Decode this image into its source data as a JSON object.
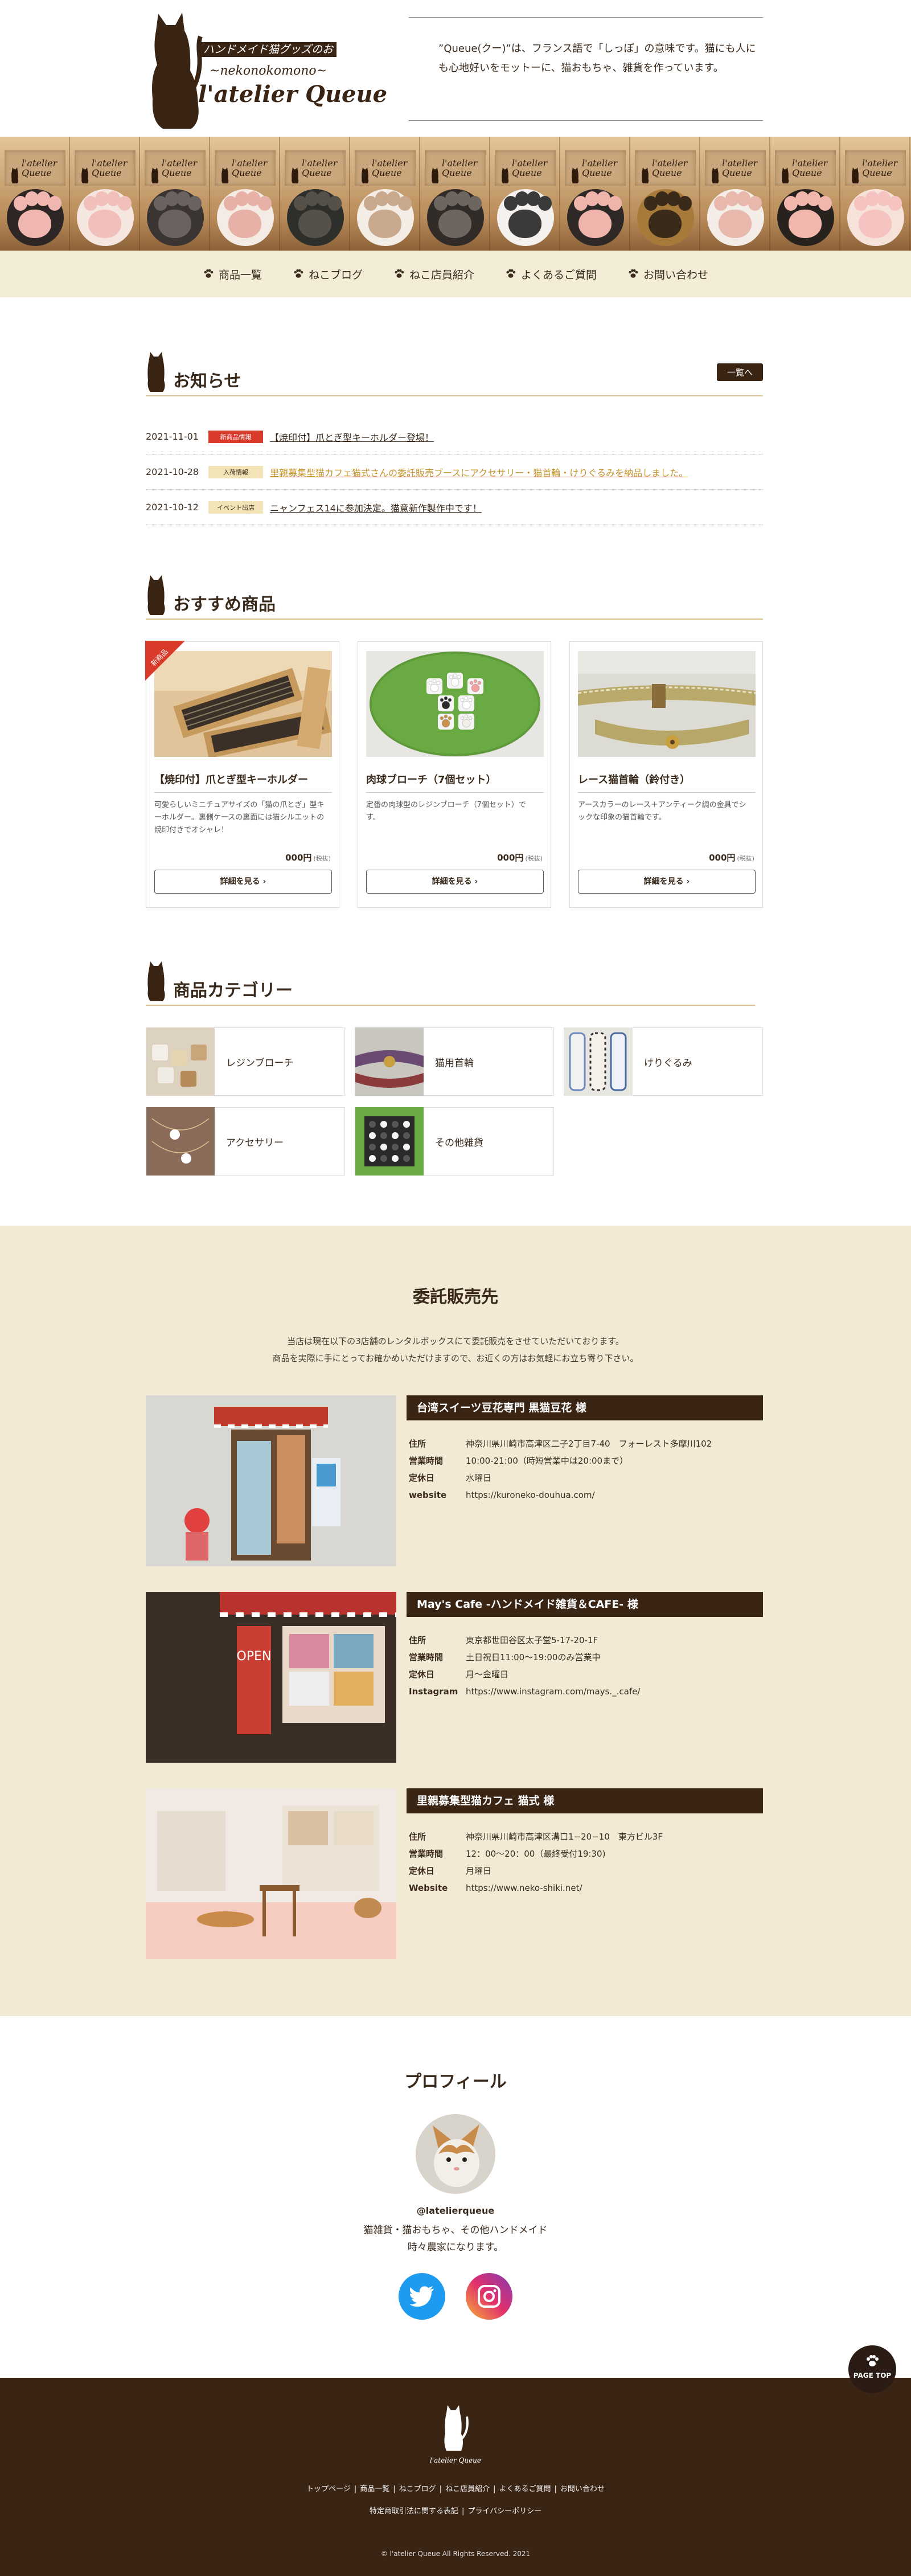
{
  "header": {
    "tagline": "ハンドメイド猫グッズのお店",
    "subname": "~nekonokomono~",
    "shop_name": "l'atelier Queue",
    "intro": "”Queue(クー)”は、フランス語で「しっぽ」の意味です。猫にも人にも心地好いをモットーに、猫おもちゃ、雑貨を作っています。"
  },
  "banner": {
    "tag_text": "l'atelier Queue"
  },
  "nav": [
    {
      "label": "商品一覧"
    },
    {
      "label": "ねこブログ"
    },
    {
      "label": "ねこ店員紹介"
    },
    {
      "label": "よくあるご質問"
    },
    {
      "label": "お問い合わせ"
    }
  ],
  "news": {
    "title": "お知らせ",
    "more": "一覧へ",
    "items": [
      {
        "date": "2021-11-01",
        "badge": "新商品情報",
        "badge_color": "#d93a2a",
        "text": "【焼印付】爪とぎ型キーホルダー登場！",
        "text_color": "#3a2a1c"
      },
      {
        "date": "2021-10-28",
        "badge": "入荷情報",
        "badge_color": "#f3e4b8",
        "text": "里親募集型猫カフェ猫式さんの委託販売ブースにアクセサリー・猫首輪・けりぐるみを納品しました。",
        "text_color": "#c4932a"
      },
      {
        "date": "2021-10-12",
        "badge": "イベント出店",
        "badge_color": "#f3e4b8",
        "text": "ニャンフェス14に参加決定。猫意新作製作中です！",
        "text_color": "#3a2a1c"
      }
    ]
  },
  "recommend": {
    "title": "おすすめ商品",
    "ribbon": "新商品",
    "price_suffix": "(税抜)",
    "button": "詳細を見る",
    "items": [
      {
        "name": "【焼印付】爪とぎ型キーホルダー",
        "desc": "可愛らしいミニチュアサイズの「猫の爪とぎ」型キーホルダー。裏側ケースの裏面には猫シルエットの焼印付きでオシャレ！",
        "price": "000円"
      },
      {
        "name": "肉球ブローチ（7個セット）",
        "desc": "定番の肉球型のレジンブローチ（7個セット）です。",
        "price": "000円"
      },
      {
        "name": "レース猫首輪（鈴付き）",
        "desc": "アースカラーのレース＋アンティーク調の金具でシックな印象の猫首輪です。",
        "price": "000円"
      }
    ]
  },
  "categories": {
    "title": "商品カテゴリー",
    "items": [
      {
        "label": "レジンブローチ"
      },
      {
        "label": "猫用首輪"
      },
      {
        "label": "けりぐるみ"
      },
      {
        "label": "アクセサリー"
      },
      {
        "label": "その他雑貨"
      }
    ]
  },
  "consignment": {
    "title": "委託販売先",
    "lead1": "当店は現在以下の3店舗のレンタルボックスにて委託販売をさせていただいております。",
    "lead2": "商品を実際に手にとってお確かめいただけますので、お近くの方はお気軽にお立ち寄り下さい。",
    "shops": [
      {
        "name": "台湾スイーツ豆花専門 黒猫豆花 様",
        "rows": [
          {
            "k": "住所",
            "v": "神奈川県川崎市高津区二子2丁目7-40　フォーレスト多摩川102"
          },
          {
            "k": "営業時間",
            "v": "10:00-21:00（時短営業中は20:00まで）"
          },
          {
            "k": "定休日",
            "v": "水曜日"
          },
          {
            "k": "website",
            "v": "https://kuroneko-douhua.com/"
          }
        ]
      },
      {
        "name": "May's Cafe -ハンドメイド雑貨＆CAFE- 様",
        "rows": [
          {
            "k": "住所",
            "v": "東京都世田谷区太子堂5-17-20-1F"
          },
          {
            "k": "営業時間",
            "v": "土日祝日11:00〜19:00のみ営業中"
          },
          {
            "k": "定休日",
            "v": "月〜金曜日"
          },
          {
            "k": "Instagram",
            "v": "https://www.instagram.com/mays._.cafe/"
          }
        ]
      },
      {
        "name": "里親募集型猫カフェ 猫式 様",
        "rows": [
          {
            "k": "住所",
            "v": "神奈川県川崎市高津区溝口1−20−10　東方ビル3F"
          },
          {
            "k": "営業時間",
            "v": "12：00〜20：00（最終受付19:30)"
          },
          {
            "k": "定休日",
            "v": "月曜日"
          },
          {
            "k": "Website",
            "v": "https://www.neko-shiki.net/"
          }
        ]
      }
    ]
  },
  "profile": {
    "title": "プロフィール",
    "handle": "@latelierqueue",
    "desc1": "猫雑貨・猫おもちゃ、その他ハンドメイド",
    "desc2": "時々農家になります。"
  },
  "page_top": "PAGE TOP",
  "footer": {
    "logo": "l'atelier Queue",
    "links": [
      "トップページ",
      "商品一覧",
      "ねこブログ",
      "ねこ店員紹介",
      "よくあるご質問",
      "お問い合わせ"
    ],
    "links2": [
      "特定商取引法に関する表記",
      "プライバシーポリシー"
    ],
    "copyright": "© l'atelier Queue All Rights Reserved. 2021"
  },
  "colors": {
    "brown": "#3a2414",
    "cream": "#f3ead6",
    "gold": "#d9c38d",
    "red": "#d93a2a",
    "twitter": "#1d9bf0"
  }
}
